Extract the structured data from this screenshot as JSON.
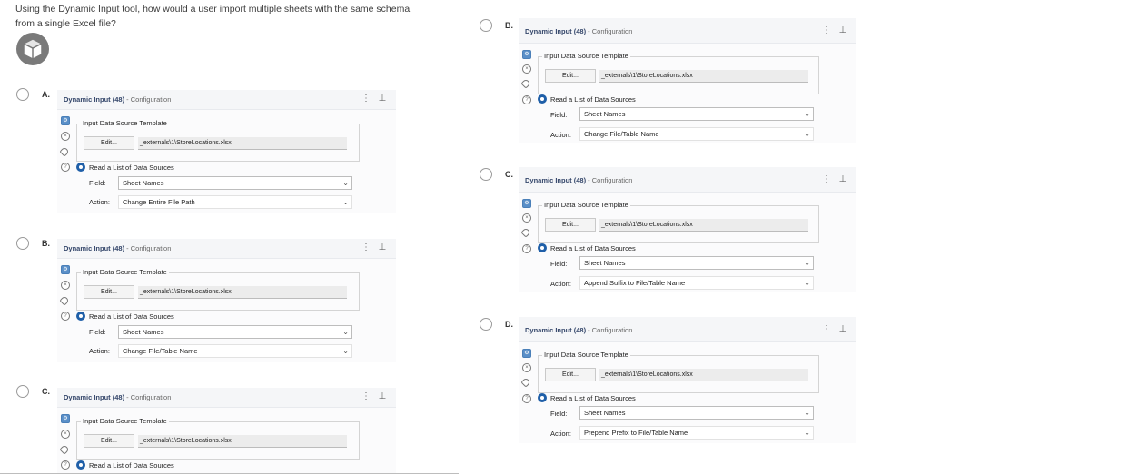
{
  "question": {
    "line1": "Using the Dynamic Input tool, how would a user import multiple sheets with the same schema",
    "line2": "from a single Excel file?"
  },
  "panel_common": {
    "tool_name": "Dynamic Input (48)",
    "config_suffix": " - Configuration",
    "menu_glyph": "⋮",
    "pin_glyph": "⊥",
    "template_label": "Input Data Source Template",
    "edit_label": "Edit...",
    "path_value": "_externals\\1\\StoreLocations.xlsx",
    "read_list_label": "Read a List of Data Sources",
    "field_label": "Field:",
    "field_value": "Sheet Names",
    "action_label": "Action:"
  },
  "options": [
    {
      "letter": "A.",
      "action_value": "Change Entire File Path"
    },
    {
      "letter": "B.",
      "action_value": "Change File/Table Name"
    },
    {
      "letter": "C.",
      "action_value": ""
    },
    {
      "letter": "B.",
      "action_value": "Change File/Table Name"
    },
    {
      "letter": "C.",
      "action_value": "Append Suffix to File/Table Name"
    },
    {
      "letter": "D.",
      "action_value": "Prepend Prefix to File/Table Name"
    }
  ],
  "colors": {
    "accent": "#1f5fa8",
    "panel_bg": "#fbfbfc",
    "title": "#34466a"
  },
  "icons": [
    "knowledge-cube-icon",
    "settings-icon",
    "close-circle-icon",
    "tag-icon",
    "help-icon",
    "menu-dots-icon",
    "pin-icon",
    "chevron-down-icon"
  ]
}
